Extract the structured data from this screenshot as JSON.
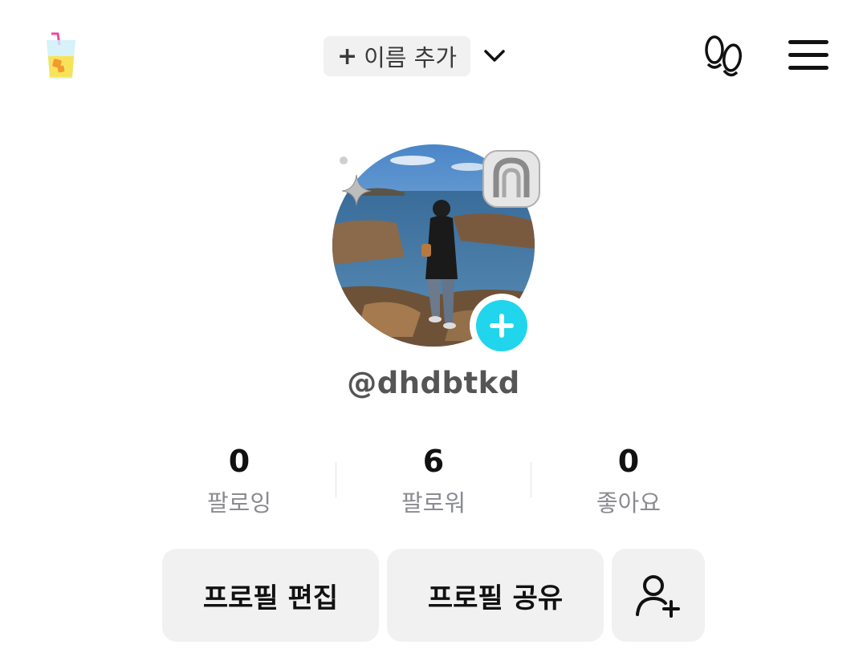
{
  "header": {
    "add_name_plus": "+",
    "add_name_label": "이름 추가",
    "icons": {
      "left": "drink-cup-icon",
      "dropdown": "chevron-down-icon",
      "visitors": "footprint-icon",
      "menu": "hamburger-menu-icon"
    }
  },
  "profile": {
    "username": "@dhdbtkd",
    "avatar_alt": "profile-photo",
    "add_button_icon": "plus-icon",
    "accent": "#20d5ec"
  },
  "stats": [
    {
      "value": "0",
      "label": "팔로잉"
    },
    {
      "value": "6",
      "label": "팔로워"
    },
    {
      "value": "0",
      "label": "좋아요"
    }
  ],
  "actions": {
    "edit_label": "프로필 편집",
    "share_label": "프로필 공유",
    "add_friend_icon": "add-user-icon"
  }
}
